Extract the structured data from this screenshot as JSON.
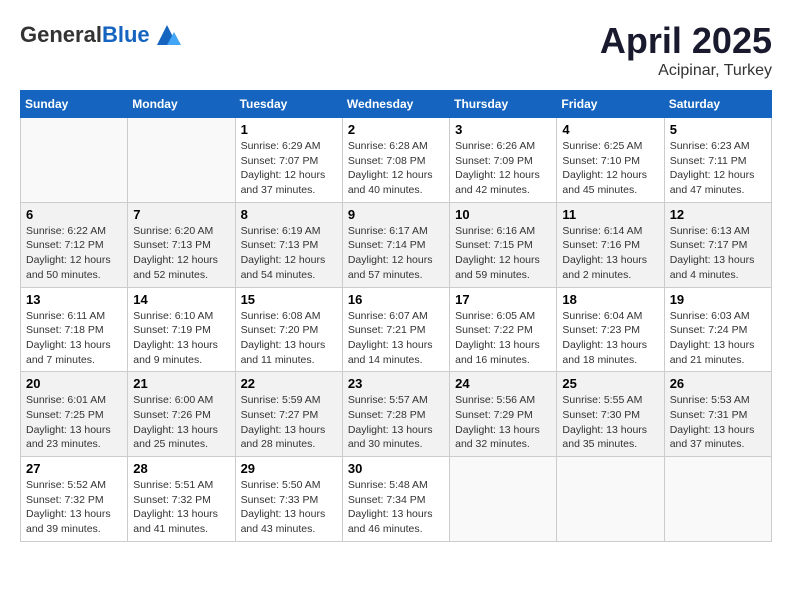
{
  "header": {
    "logo_general": "General",
    "logo_blue": "Blue",
    "month": "April 2025",
    "location": "Acipinar, Turkey"
  },
  "weekdays": [
    "Sunday",
    "Monday",
    "Tuesday",
    "Wednesday",
    "Thursday",
    "Friday",
    "Saturday"
  ],
  "weeks": [
    [
      {
        "day": "",
        "sunrise": "",
        "sunset": "",
        "daylight": ""
      },
      {
        "day": "",
        "sunrise": "",
        "sunset": "",
        "daylight": ""
      },
      {
        "day": "1",
        "sunrise": "Sunrise: 6:29 AM",
        "sunset": "Sunset: 7:07 PM",
        "daylight": "Daylight: 12 hours and 37 minutes."
      },
      {
        "day": "2",
        "sunrise": "Sunrise: 6:28 AM",
        "sunset": "Sunset: 7:08 PM",
        "daylight": "Daylight: 12 hours and 40 minutes."
      },
      {
        "day": "3",
        "sunrise": "Sunrise: 6:26 AM",
        "sunset": "Sunset: 7:09 PM",
        "daylight": "Daylight: 12 hours and 42 minutes."
      },
      {
        "day": "4",
        "sunrise": "Sunrise: 6:25 AM",
        "sunset": "Sunset: 7:10 PM",
        "daylight": "Daylight: 12 hours and 45 minutes."
      },
      {
        "day": "5",
        "sunrise": "Sunrise: 6:23 AM",
        "sunset": "Sunset: 7:11 PM",
        "daylight": "Daylight: 12 hours and 47 minutes."
      }
    ],
    [
      {
        "day": "6",
        "sunrise": "Sunrise: 6:22 AM",
        "sunset": "Sunset: 7:12 PM",
        "daylight": "Daylight: 12 hours and 50 minutes."
      },
      {
        "day": "7",
        "sunrise": "Sunrise: 6:20 AM",
        "sunset": "Sunset: 7:13 PM",
        "daylight": "Daylight: 12 hours and 52 minutes."
      },
      {
        "day": "8",
        "sunrise": "Sunrise: 6:19 AM",
        "sunset": "Sunset: 7:13 PM",
        "daylight": "Daylight: 12 hours and 54 minutes."
      },
      {
        "day": "9",
        "sunrise": "Sunrise: 6:17 AM",
        "sunset": "Sunset: 7:14 PM",
        "daylight": "Daylight: 12 hours and 57 minutes."
      },
      {
        "day": "10",
        "sunrise": "Sunrise: 6:16 AM",
        "sunset": "Sunset: 7:15 PM",
        "daylight": "Daylight: 12 hours and 59 minutes."
      },
      {
        "day": "11",
        "sunrise": "Sunrise: 6:14 AM",
        "sunset": "Sunset: 7:16 PM",
        "daylight": "Daylight: 13 hours and 2 minutes."
      },
      {
        "day": "12",
        "sunrise": "Sunrise: 6:13 AM",
        "sunset": "Sunset: 7:17 PM",
        "daylight": "Daylight: 13 hours and 4 minutes."
      }
    ],
    [
      {
        "day": "13",
        "sunrise": "Sunrise: 6:11 AM",
        "sunset": "Sunset: 7:18 PM",
        "daylight": "Daylight: 13 hours and 7 minutes."
      },
      {
        "day": "14",
        "sunrise": "Sunrise: 6:10 AM",
        "sunset": "Sunset: 7:19 PM",
        "daylight": "Daylight: 13 hours and 9 minutes."
      },
      {
        "day": "15",
        "sunrise": "Sunrise: 6:08 AM",
        "sunset": "Sunset: 7:20 PM",
        "daylight": "Daylight: 13 hours and 11 minutes."
      },
      {
        "day": "16",
        "sunrise": "Sunrise: 6:07 AM",
        "sunset": "Sunset: 7:21 PM",
        "daylight": "Daylight: 13 hours and 14 minutes."
      },
      {
        "day": "17",
        "sunrise": "Sunrise: 6:05 AM",
        "sunset": "Sunset: 7:22 PM",
        "daylight": "Daylight: 13 hours and 16 minutes."
      },
      {
        "day": "18",
        "sunrise": "Sunrise: 6:04 AM",
        "sunset": "Sunset: 7:23 PM",
        "daylight": "Daylight: 13 hours and 18 minutes."
      },
      {
        "day": "19",
        "sunrise": "Sunrise: 6:03 AM",
        "sunset": "Sunset: 7:24 PM",
        "daylight": "Daylight: 13 hours and 21 minutes."
      }
    ],
    [
      {
        "day": "20",
        "sunrise": "Sunrise: 6:01 AM",
        "sunset": "Sunset: 7:25 PM",
        "daylight": "Daylight: 13 hours and 23 minutes."
      },
      {
        "day": "21",
        "sunrise": "Sunrise: 6:00 AM",
        "sunset": "Sunset: 7:26 PM",
        "daylight": "Daylight: 13 hours and 25 minutes."
      },
      {
        "day": "22",
        "sunrise": "Sunrise: 5:59 AM",
        "sunset": "Sunset: 7:27 PM",
        "daylight": "Daylight: 13 hours and 28 minutes."
      },
      {
        "day": "23",
        "sunrise": "Sunrise: 5:57 AM",
        "sunset": "Sunset: 7:28 PM",
        "daylight": "Daylight: 13 hours and 30 minutes."
      },
      {
        "day": "24",
        "sunrise": "Sunrise: 5:56 AM",
        "sunset": "Sunset: 7:29 PM",
        "daylight": "Daylight: 13 hours and 32 minutes."
      },
      {
        "day": "25",
        "sunrise": "Sunrise: 5:55 AM",
        "sunset": "Sunset: 7:30 PM",
        "daylight": "Daylight: 13 hours and 35 minutes."
      },
      {
        "day": "26",
        "sunrise": "Sunrise: 5:53 AM",
        "sunset": "Sunset: 7:31 PM",
        "daylight": "Daylight: 13 hours and 37 minutes."
      }
    ],
    [
      {
        "day": "27",
        "sunrise": "Sunrise: 5:52 AM",
        "sunset": "Sunset: 7:32 PM",
        "daylight": "Daylight: 13 hours and 39 minutes."
      },
      {
        "day": "28",
        "sunrise": "Sunrise: 5:51 AM",
        "sunset": "Sunset: 7:32 PM",
        "daylight": "Daylight: 13 hours and 41 minutes."
      },
      {
        "day": "29",
        "sunrise": "Sunrise: 5:50 AM",
        "sunset": "Sunset: 7:33 PM",
        "daylight": "Daylight: 13 hours and 43 minutes."
      },
      {
        "day": "30",
        "sunrise": "Sunrise: 5:48 AM",
        "sunset": "Sunset: 7:34 PM",
        "daylight": "Daylight: 13 hours and 46 minutes."
      },
      {
        "day": "",
        "sunrise": "",
        "sunset": "",
        "daylight": ""
      },
      {
        "day": "",
        "sunrise": "",
        "sunset": "",
        "daylight": ""
      },
      {
        "day": "",
        "sunrise": "",
        "sunset": "",
        "daylight": ""
      }
    ]
  ]
}
